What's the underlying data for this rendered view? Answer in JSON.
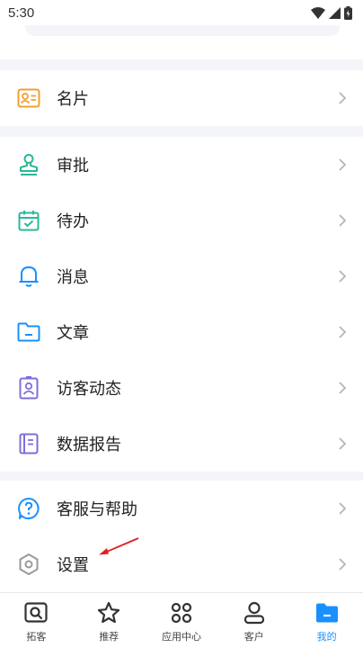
{
  "status_bar": {
    "time": "5:30"
  },
  "sections": [
    {
      "items": [
        {
          "label": "名片",
          "icon": "business-card-icon"
        }
      ]
    },
    {
      "items": [
        {
          "label": "审批",
          "icon": "stamp-icon"
        },
        {
          "label": "待办",
          "icon": "calendar-check-icon"
        },
        {
          "label": "消息",
          "icon": "bell-icon"
        },
        {
          "label": "文章",
          "icon": "folder-icon"
        },
        {
          "label": "访客动态",
          "icon": "visitor-badge-icon"
        },
        {
          "label": "数据报告",
          "icon": "report-icon"
        }
      ]
    },
    {
      "items": [
        {
          "label": "客服与帮助",
          "icon": "help-bubble-icon"
        },
        {
          "label": "设置",
          "icon": "settings-hexagon-icon"
        }
      ]
    }
  ],
  "bottom_nav": [
    {
      "label": "拓客",
      "icon": "search-card-icon",
      "active": false
    },
    {
      "label": "推荐",
      "icon": "star-icon",
      "active": false
    },
    {
      "label": "应用中心",
      "icon": "grid-apps-icon",
      "active": false
    },
    {
      "label": "客户",
      "icon": "person-icon",
      "active": false
    },
    {
      "label": "我的",
      "icon": "folder-filled-icon",
      "active": true
    }
  ],
  "colors": {
    "accent": "#1890ff",
    "orange": "#f0a030",
    "teal": "#2bb89a",
    "purple": "#7e6fd8",
    "annotation_arrow": "#e02020"
  }
}
